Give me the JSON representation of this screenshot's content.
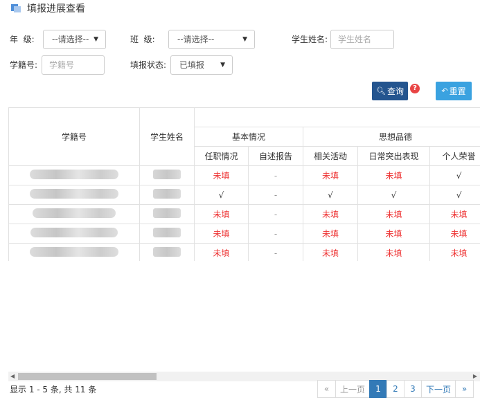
{
  "page": {
    "title": "填报进展查看"
  },
  "filters": {
    "grade_label": "年  级:",
    "grade_value": "--请选择--",
    "class_label": "班  级:",
    "class_value": "--请选择--",
    "name_label": "学生姓名:",
    "name_placeholder": "学生姓名",
    "id_label": "学籍号:",
    "id_placeholder": "学籍号",
    "status_label": "填报状态:",
    "status_value": "已填报"
  },
  "actions": {
    "query_label": "查询",
    "help_symbol": "?",
    "reset_label": "重置"
  },
  "table": {
    "col_id": "学籍号",
    "col_name": "学生姓名",
    "group_basic": "基本情况",
    "group_moral": "思想品德",
    "sub_headers": [
      "任职情况",
      "自述报告",
      "相关活动",
      "日常突出表现",
      "个人荣誉"
    ],
    "rows": [
      [
        "未填",
        "-",
        "未填",
        "未填",
        "√"
      ],
      [
        "√",
        "-",
        "√",
        "√",
        "√"
      ],
      [
        "未填",
        "-",
        "未填",
        "未填",
        "未填"
      ],
      [
        "未填",
        "-",
        "未填",
        "未填",
        "未填"
      ],
      [
        "未填",
        "-",
        "未填",
        "未填",
        "未填"
      ]
    ]
  },
  "footer": {
    "info": "显示 1 - 5 条, 共 11 条"
  },
  "pagination": {
    "first": "«",
    "prev": "上一页",
    "pages": [
      "1",
      "2",
      "3"
    ],
    "active_page": "1",
    "next": "下一页",
    "last": "»"
  },
  "colors": {
    "accent": "#24558f",
    "reset": "#3aa2e0",
    "warning": "#e33333"
  }
}
